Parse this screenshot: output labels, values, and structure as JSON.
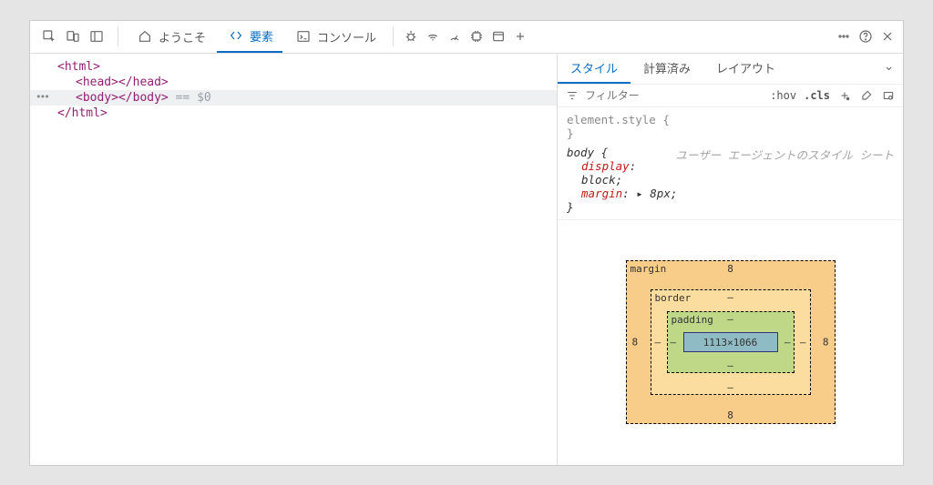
{
  "toolbar": {
    "tabs": {
      "welcome": "ようこそ",
      "elements": "要素",
      "console": "コンソール"
    }
  },
  "dom": {
    "html_open": "<html>",
    "head": "<head></head>",
    "body_open": "<body>",
    "body_close": "</body>",
    "body_comment": " == $0",
    "html_close": "</html>"
  },
  "styles_panel": {
    "tabs": {
      "styles": "スタイル",
      "computed": "計算済み",
      "layout": "レイアウト"
    },
    "filter_placeholder": "フィルター",
    "hov": ":hov",
    "cls": ".cls",
    "element_style_open": "element.style {",
    "close_brace": "}",
    "body_rule_open": "body {",
    "ua_label": "ユーザー エージェントのスタイル シート",
    "prop_display": "display",
    "val_display": "block",
    "prop_margin": "margin",
    "val_margin": "8px",
    "colon": ": ",
    "semicolon": ";",
    "tri": "▸ "
  },
  "boxmodel": {
    "margin_label": "margin",
    "border_label": "border",
    "padding_label": "padding",
    "margin_val": "8",
    "border_val": "–",
    "padding_val": "–",
    "content": "1113×1066"
  }
}
